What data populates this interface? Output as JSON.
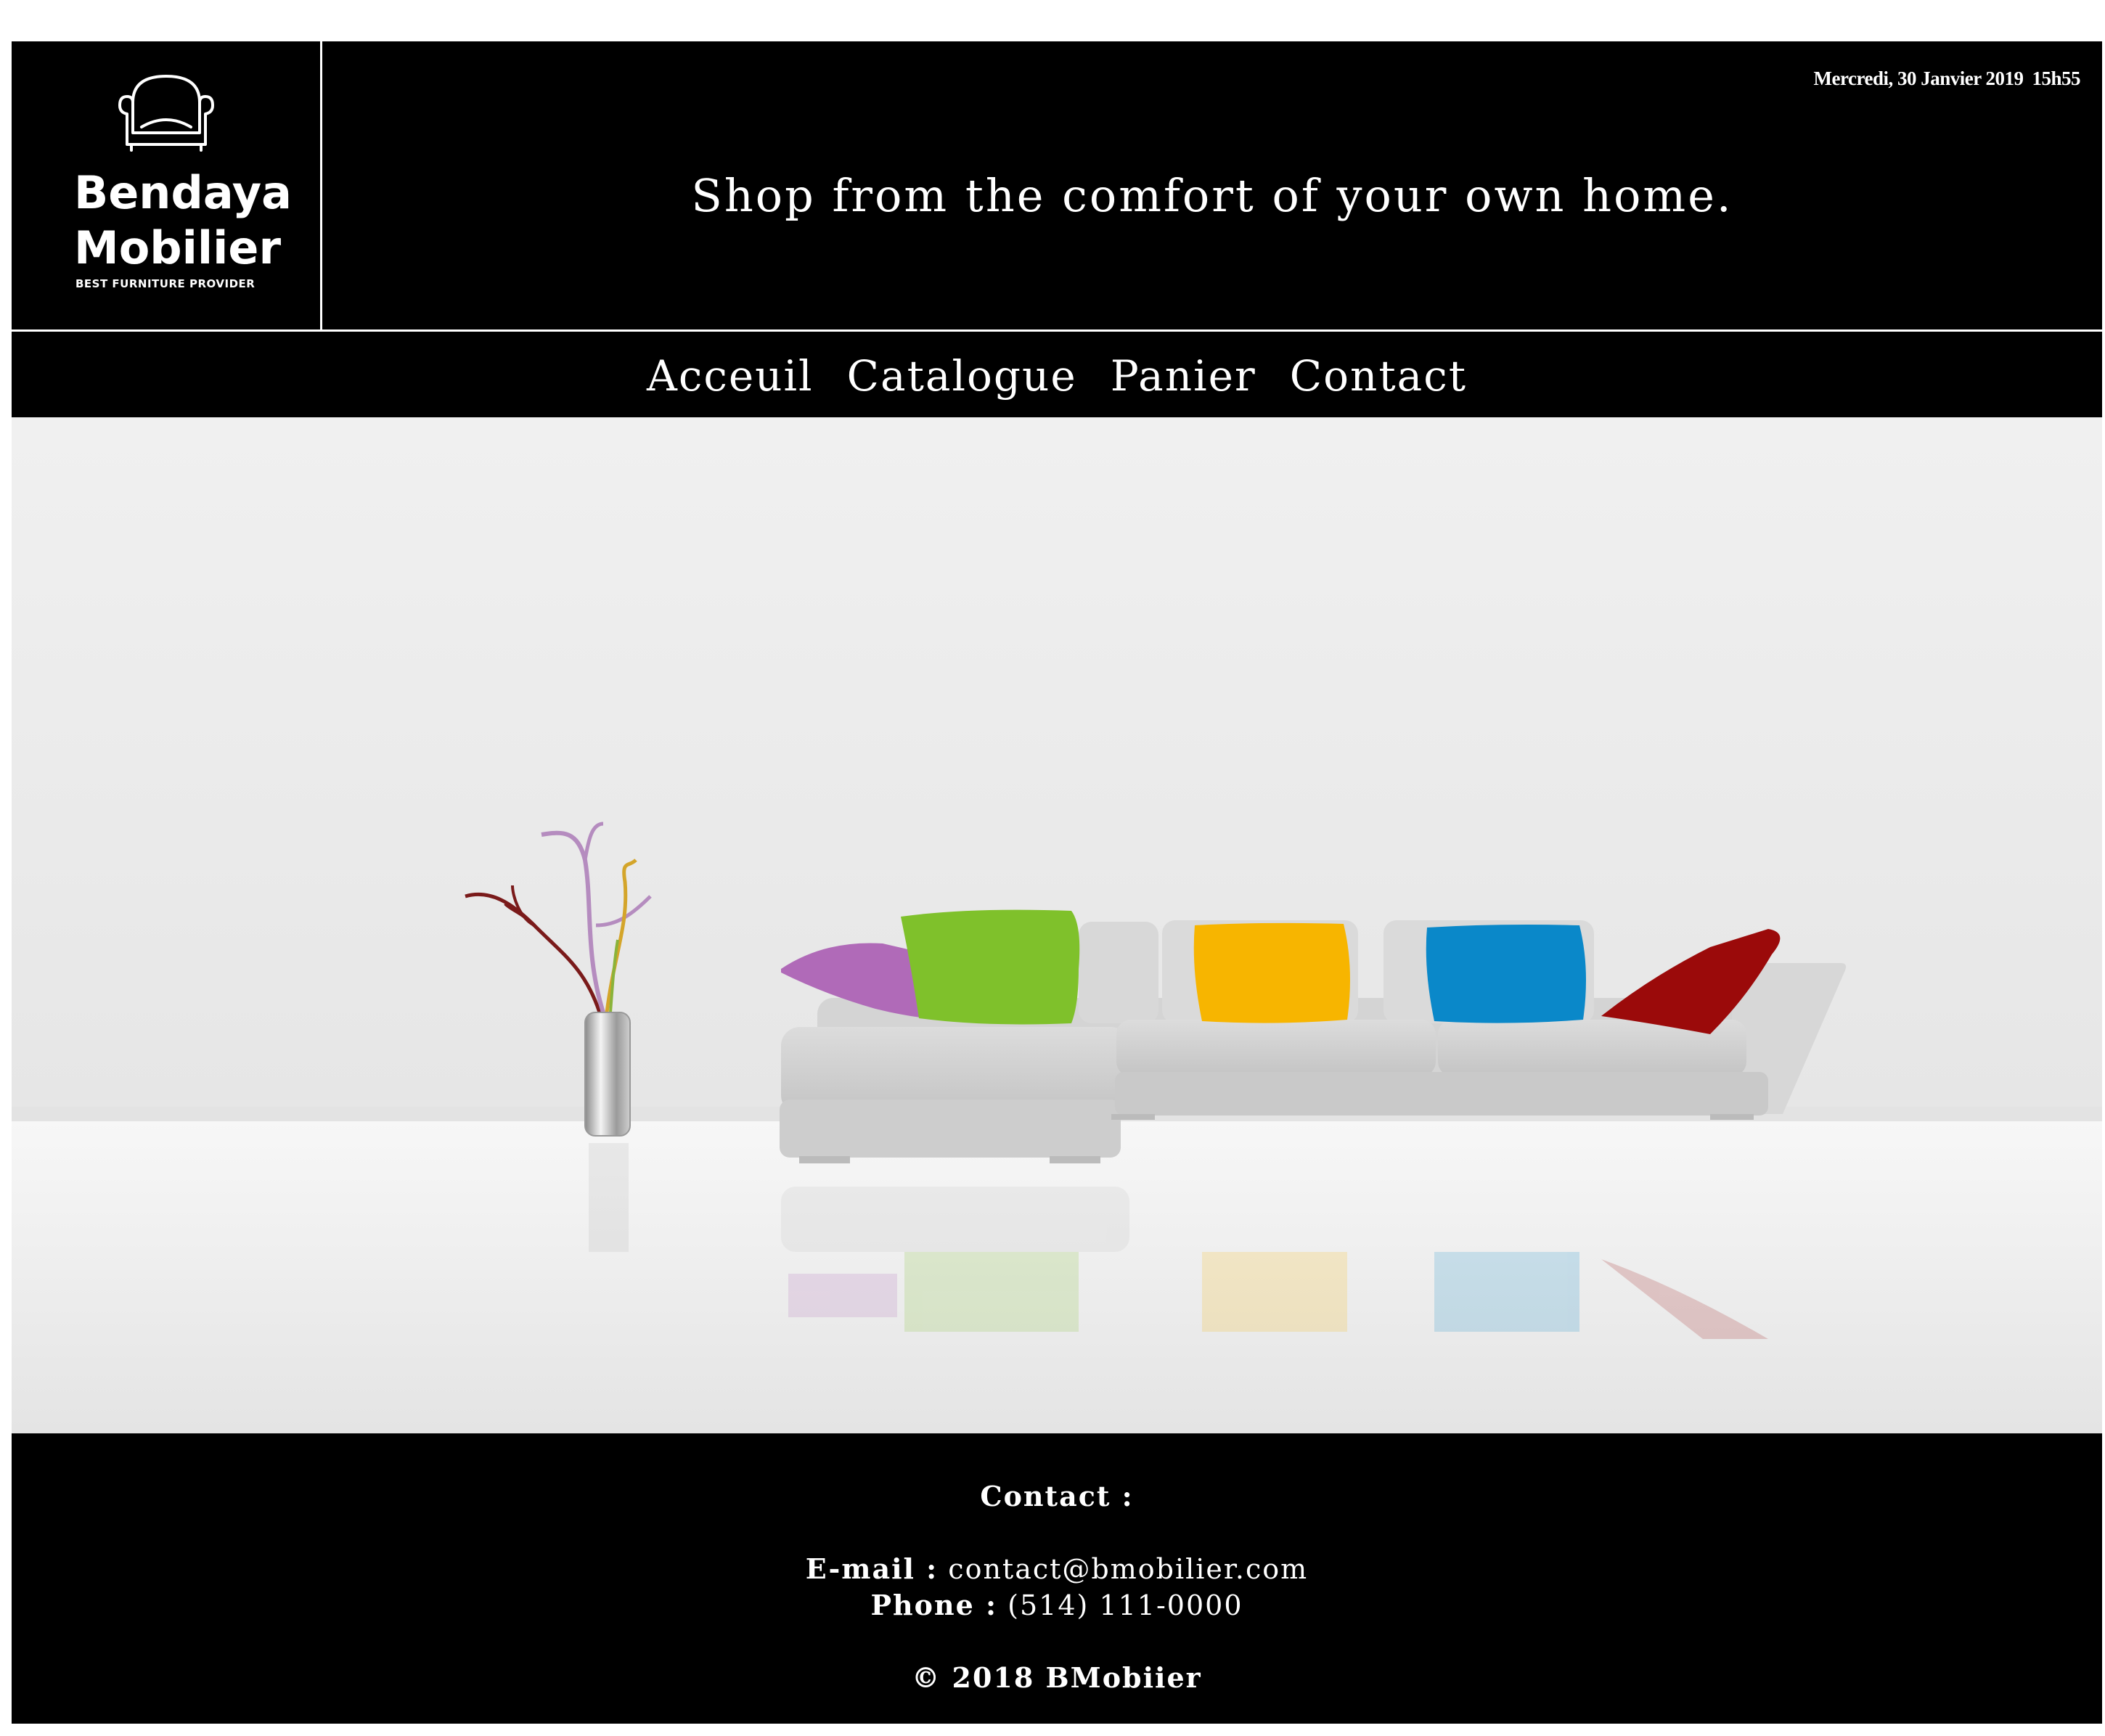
{
  "header": {
    "brand": {
      "line1": "Bendaya",
      "line2": "Mobilier",
      "tagline": "BEST FURNITURE PROVIDER",
      "icon": "armchair-icon"
    },
    "datetime": {
      "date": "Mercredi, 30 Janvier 2019",
      "time": "15h55"
    },
    "slogan": "Shop from the comfort of your own home."
  },
  "nav": {
    "items": [
      {
        "label": "Acceuil"
      },
      {
        "label": "Catalogue"
      },
      {
        "label": "Panier"
      },
      {
        "label": "Contact"
      }
    ]
  },
  "hero": {
    "image": "living-room-sofa-colorful-pillows",
    "pillow_colors": [
      "#b06ab8",
      "#7fc12b",
      "#f7b500",
      "#0a88c9",
      "#9b0a0a"
    ]
  },
  "footer": {
    "title": "Contact :",
    "email_label": "E-mail :",
    "email_value": "contact@bmobilier.com",
    "phone_label": "Phone :",
    "phone_value": "(514) 111-0000",
    "copyright": "© 2018 BMobiier"
  },
  "colors": {
    "background": "#000000",
    "text": "#ffffff",
    "page": "#ffffff"
  }
}
